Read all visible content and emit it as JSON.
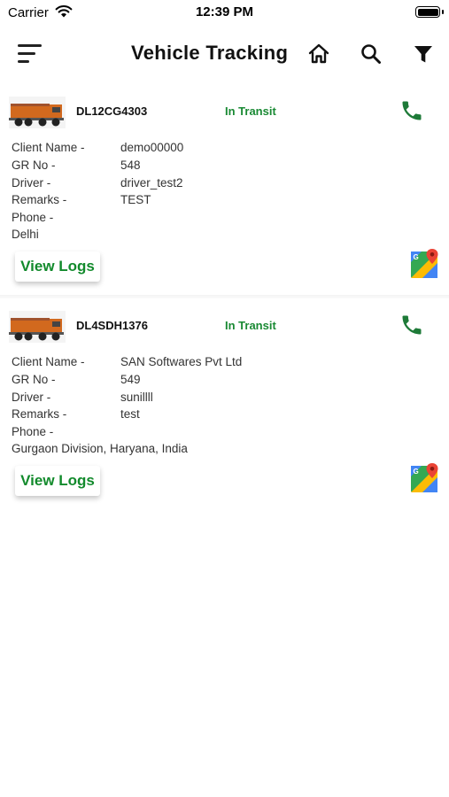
{
  "status_bar": {
    "carrier": "Carrier",
    "time": "12:39 PM"
  },
  "nav": {
    "title": "Vehicle Tracking"
  },
  "labels": {
    "client_name": "Client Name -",
    "gr_no": "GR No -",
    "driver": "Driver -",
    "remarks": "Remarks -",
    "phone": "Phone -"
  },
  "vehicles": [
    {
      "vehicle_no": "DL12CG4303",
      "status": "In Transit",
      "client_name": "demo00000",
      "gr_no": "548",
      "driver": "driver_test2",
      "remarks": "TEST",
      "phone": "",
      "location": "Delhi",
      "view_logs_label": "View Logs"
    },
    {
      "vehicle_no": "DL4SDH1376",
      "status": "In Transit",
      "client_name": "SAN Softwares Pvt Ltd",
      "gr_no": "549",
      "driver": "sunillll",
      "remarks": "test",
      "phone": "",
      "location": "Gurgaon Division, Haryana, India",
      "view_logs_label": "View Logs"
    }
  ],
  "colors": {
    "accent_green": "#1a8a34",
    "phone_green": "#1e7a38"
  }
}
